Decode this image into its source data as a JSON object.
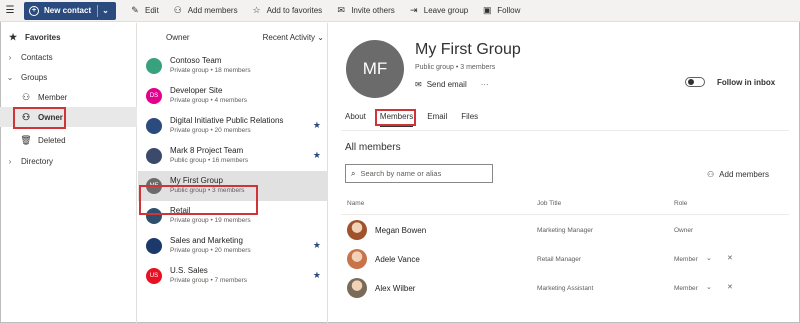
{
  "toolbar": {
    "new_contact": "New contact",
    "items": [
      "Edit",
      "Add members",
      "Add to favorites",
      "Invite others",
      "Leave group",
      "Follow"
    ]
  },
  "nav": {
    "favorites": "Favorites",
    "contacts": "Contacts",
    "groups": "Groups",
    "member": "Member",
    "owner": "Owner",
    "deleted": "Deleted",
    "directory": "Directory"
  },
  "list": {
    "header_left": "Owner",
    "header_right": "Recent Activity",
    "groups": [
      {
        "initials": "",
        "name": "Contoso Team",
        "sub": "Private group • 18 members",
        "color": "#3aa17e",
        "star": false
      },
      {
        "initials": "DS",
        "name": "Developer Site",
        "sub": "Private group • 4 members",
        "color": "#e3008c",
        "star": false
      },
      {
        "initials": "",
        "name": "Digital Initiative Public Relations",
        "sub": "Private group • 20 members",
        "color": "#2b4a7e",
        "star": true
      },
      {
        "initials": "",
        "name": "Mark 8 Project Team",
        "sub": "Public group • 16 members",
        "color": "#3b4a6b",
        "star": true
      },
      {
        "initials": "MF",
        "name": "My First Group",
        "sub": "Public group • 3 members",
        "color": "#6b6b6b",
        "star": false
      },
      {
        "initials": "",
        "name": "Retail",
        "sub": "Private group • 19 members",
        "color": "#2f4f6f",
        "star": false
      },
      {
        "initials": "",
        "name": "Sales and Marketing",
        "sub": "Private group • 20 members",
        "color": "#1b3a6b",
        "star": true
      },
      {
        "initials": "US",
        "name": "U.S. Sales",
        "sub": "Private group • 7 members",
        "color": "#e81123",
        "star": true
      }
    ]
  },
  "detail": {
    "initials": "MF",
    "title": "My First Group",
    "subtitle": "Public group • 3 members",
    "send_email": "Send email",
    "more": "···",
    "follow": "Follow in inbox",
    "tabs": [
      "About",
      "Members",
      "Email",
      "Files"
    ],
    "section_title": "All members",
    "search_placeholder": "Search by name or alias",
    "add_members": "Add members",
    "columns": {
      "name": "Name",
      "job": "Job Title",
      "role": "Role"
    },
    "members": [
      {
        "name": "Megan Bowen",
        "job": "Marketing Manager",
        "role": "Owner",
        "color": "#a0522d"
      },
      {
        "name": "Adele Vance",
        "job": "Retail Manager",
        "role": "Member",
        "color": "#c8734a"
      },
      {
        "name": "Alex Wilber",
        "job": "Marketing Assistant",
        "role": "Member",
        "color": "#7a6a5a"
      }
    ]
  }
}
